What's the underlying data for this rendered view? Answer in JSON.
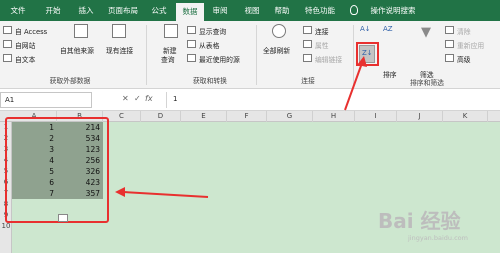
{
  "menu": {
    "tabs": [
      {
        "label": "文件"
      },
      {
        "label": "开始"
      },
      {
        "label": "插入"
      },
      {
        "label": "页面布局"
      },
      {
        "label": "公式"
      },
      {
        "label": "数据"
      },
      {
        "label": "审阅"
      },
      {
        "label": "视图"
      },
      {
        "label": "帮助"
      },
      {
        "label": "特色功能"
      }
    ],
    "active": "数据",
    "tell_me": "操作说明搜索"
  },
  "ribbon": {
    "get_external": {
      "access": "自 Access",
      "web": "自网站",
      "text": "自文本",
      "other": "自其他来源",
      "existing": "现有连接",
      "label": "获取外部数据"
    },
    "get_transform": {
      "new_query": "新建",
      "new_query2": "查询",
      "show_queries": "显示查询",
      "from_table": "从表格",
      "recent": "最近使用的源",
      "label": "获取和转换"
    },
    "connections": {
      "refresh_all": "全部刷新",
      "connections": "连接",
      "properties": "属性",
      "edit_links": "编辑链接",
      "label": "连接"
    },
    "sort_filter": {
      "sort": "排序",
      "filter": "筛选",
      "clear": "清除",
      "reapply": "重新应用",
      "advanced": "高级",
      "label": "排序和筛选"
    }
  },
  "formula_bar": {
    "name_box": "A1",
    "cancel": "✕",
    "enter": "✓",
    "fx": "fx",
    "value": "1"
  },
  "sheet": {
    "columns": [
      "A",
      "B",
      "C",
      "D",
      "E",
      "F",
      "G",
      "H",
      "I",
      "J",
      "K"
    ],
    "rows": [
      "1",
      "2",
      "3",
      "4",
      "5",
      "6",
      "7",
      "8",
      "9",
      "10"
    ],
    "data": [
      {
        "a": "1",
        "b": "214"
      },
      {
        "a": "2",
        "b": "534"
      },
      {
        "a": "3",
        "b": "123"
      },
      {
        "a": "4",
        "b": "256"
      },
      {
        "a": "5",
        "b": "326"
      },
      {
        "a": "6",
        "b": "423"
      },
      {
        "a": "7",
        "b": "357"
      }
    ]
  },
  "watermark": {
    "text": "Bai 经验",
    "sub": "jingyan.baidu.com"
  },
  "colors": {
    "excel_green": "#217346",
    "highlight_red": "#e8302f",
    "selection": "#8fa28f",
    "sheet_bg": "#cde7cf"
  }
}
